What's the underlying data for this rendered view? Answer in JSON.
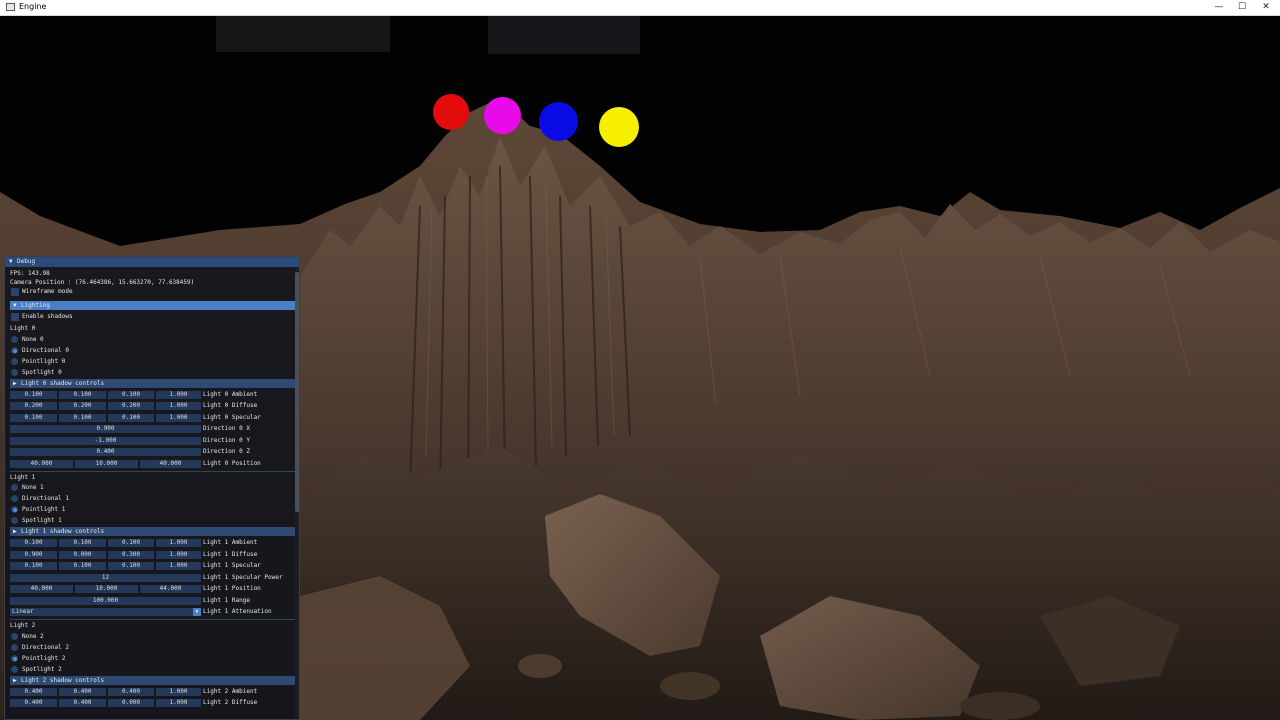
{
  "window": {
    "title": "Engine",
    "minimize_glyph": "—",
    "maximize_glyph": "☐",
    "close_glyph": "✕"
  },
  "scene": {
    "light_colors": [
      "#e30b0b",
      "#e80ae8",
      "#0b0be6",
      "#f7ef00"
    ]
  },
  "debug": {
    "title": "Debug",
    "fps": "FPS: 143.98",
    "camera": "Camera Position : (76.464386, 15.663270, 77.638459)",
    "wireframe": "Wireframe mode",
    "lighting_header": "Lighting",
    "enable_shadows": "Enable shadows",
    "lights": [
      {
        "title": "Light 0",
        "options": [
          "None 0",
          "Directional 0",
          "Pointlight 0",
          "Spotlight 0"
        ],
        "selected": 1,
        "shadow_controls": "Light 0 shadow controls",
        "ambient": {
          "values": [
            "0.100",
            "0.100",
            "0.100",
            "1.000"
          ],
          "label": "Light 0 Ambient"
        },
        "diffuse": {
          "values": [
            "0.200",
            "0.200",
            "0.200",
            "1.000"
          ],
          "label": "Light 0 Diffuse"
        },
        "specular": {
          "values": [
            "0.100",
            "0.100",
            "0.100",
            "1.000"
          ],
          "label": "Light 0 Specular"
        },
        "dir_x": {
          "value": "0.900",
          "label": "Direction 0 X"
        },
        "dir_y": {
          "value": "-1.000",
          "label": "Direction 0 Y"
        },
        "dir_z": {
          "value": "0.400",
          "label": "Direction 0 Z"
        },
        "position": {
          "values": [
            "40.000",
            "10.000",
            "40.000"
          ],
          "label": "Light 0 Position"
        }
      },
      {
        "title": "Light 1",
        "options": [
          "None 1",
          "Directional 1",
          "Pointlight 1",
          "Spotlight 1"
        ],
        "selected": 2,
        "shadow_controls": "Light 1 shadow controls",
        "ambient": {
          "values": [
            "0.100",
            "0.100",
            "0.100",
            "1.000"
          ],
          "label": "Light 1 Ambient"
        },
        "diffuse": {
          "values": [
            "0.900",
            "0.000",
            "0.300",
            "1.000"
          ],
          "label": "Light 1 Diffuse"
        },
        "specular": {
          "values": [
            "0.100",
            "0.100",
            "0.100",
            "1.000"
          ],
          "label": "Light 1 Specular"
        },
        "spec_power": {
          "value": "12",
          "label": "Light 1 Specular Power"
        },
        "position": {
          "values": [
            "40.000",
            "10.000",
            "44.000"
          ],
          "label": "Light 1 Position"
        },
        "range": {
          "value": "100.000",
          "label": "Light 1 Range"
        },
        "attenuation": {
          "value": "Linear",
          "label": "Light 1 Attenuation"
        }
      },
      {
        "title": "Light 2",
        "options": [
          "None 2",
          "Directional 2",
          "Pointlight 2",
          "Spotlight 2"
        ],
        "selected": 2,
        "shadow_controls": "Light 2 shadow controls",
        "ambient": {
          "values": [
            "0.400",
            "0.400",
            "0.400",
            "1.000"
          ],
          "label": "Light 2 Ambient"
        },
        "diffuse": {
          "values": [
            "0.400",
            "0.400",
            "0.000",
            "1.000"
          ],
          "label": "Light 2 Diffuse"
        }
      }
    ]
  }
}
